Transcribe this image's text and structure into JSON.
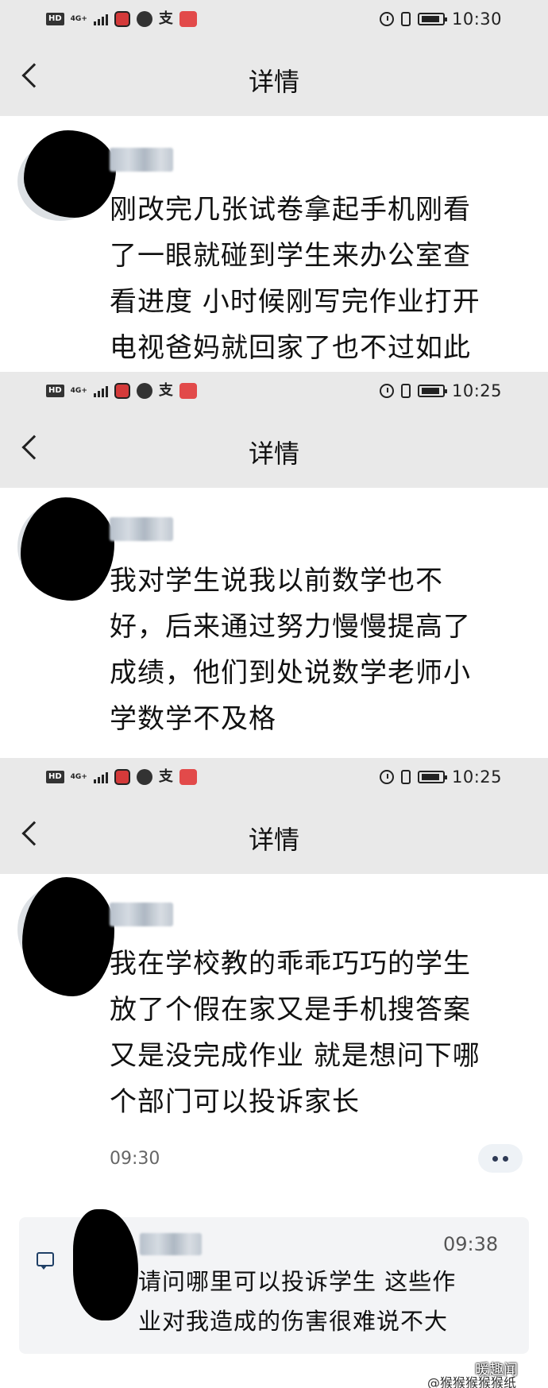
{
  "screens": [
    {
      "status": {
        "network": "4G+",
        "time": "10:30"
      },
      "header": {
        "title": "详情"
      },
      "post": {
        "text": "刚改完几张试卷拿起手机刚看\n了一眼就碰到学生来办公室查\n看进度 小时候刚写完作业打开\n电视爸妈就回家了也不过如此"
      }
    },
    {
      "status": {
        "network": "4G+",
        "time": "10:25"
      },
      "header": {
        "title": "详情"
      },
      "post": {
        "text": "我对学生说我以前数学也不\n好，后来通过努力慢慢提高了\n成绩，他们到处说数学老师小\n学数学不及格"
      }
    },
    {
      "status": {
        "network": "4G+",
        "time": "10:25"
      },
      "header": {
        "title": "详情"
      },
      "post": {
        "text": "我在学校教的乖乖巧巧的学生\n放了个假在家又是手机搜答案\n又是没完成作业 就是想问下哪\n个部门可以投诉家长",
        "timestamp": "09:30"
      },
      "reply": {
        "time": "09:38",
        "text": "请问哪里可以投诉学生 这些作\n业对我造成的伤害很难说不大"
      }
    }
  ],
  "icons": [
    "hd-icon",
    "signal-icon",
    "red-app-icon",
    "globe-icon",
    "alipay-icon",
    "red-app-icon-2",
    "alarm-icon",
    "vibrate-icon",
    "battery-icon",
    "back-arrow-icon",
    "more-icon",
    "comment-icon"
  ],
  "watermark": {
    "line1": "暖趣闻",
    "line2": "@猴猴猴猴猴纸"
  }
}
